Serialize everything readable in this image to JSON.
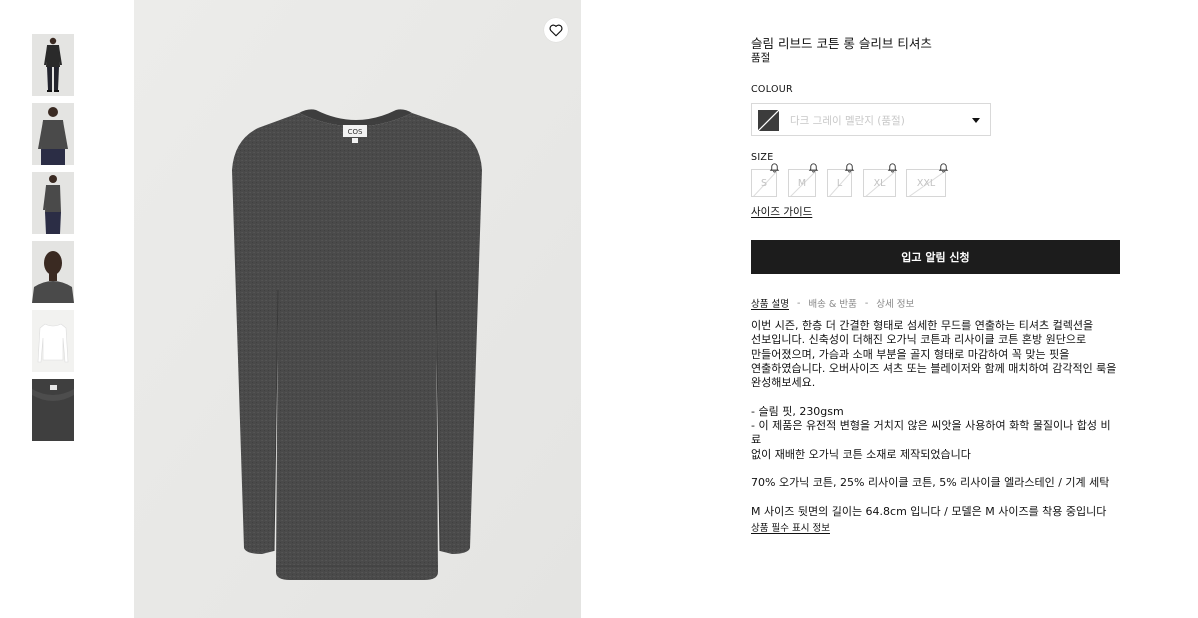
{
  "gallery": {
    "thumbnails": [
      {
        "alt": "model-full-front"
      },
      {
        "alt": "model-half-front"
      },
      {
        "alt": "model-side"
      },
      {
        "alt": "model-face-closeup"
      },
      {
        "alt": "product-flat-white"
      },
      {
        "alt": "fabric-closeup"
      }
    ],
    "main_label": "COS"
  },
  "product": {
    "title": "슬림 리브드 코튼 롱 슬리브 티셔츠",
    "stock_status": "품절",
    "colour_label": "COLOUR",
    "colour_value": "다크 그레이 멜란지 (품절)",
    "size_label": "SIZE",
    "sizes": [
      "S",
      "M",
      "L",
      "XL",
      "XXL"
    ],
    "size_guide": "사이즈 가이드",
    "notify_button": "입고 알림 신청"
  },
  "tabs": {
    "items": [
      "상품 설명",
      "배송 & 반품",
      "상세 정보"
    ],
    "separator": "-"
  },
  "description": {
    "lines_intro": [
      "이번 시즌, 한층 더 간결한 형태로 섬세한 무드를 연출하는 티셔츠 컬렉션을",
      "선보입니다. 신축성이 더해진 오가닉 코튼과 리사이클 코튼 혼방 원단으로",
      "만들어졌으며, 가슴과 소매 부분을 골지 형태로 마감하여 꼭 맞는 핏을",
      "연출하였습니다. 오버사이즈 셔츠 또는 블레이저와 함께 매치하여 감각적인 룩을",
      "완성해보세요."
    ],
    "lines_spec": [
      "- 슬림 핏, 230gsm",
      "- 이 제품은 유전적 변형을 거치지 않은 씨앗을 사용하여 화학 물질이나 합성 비료",
      "없이 재배한 오가닉 코튼 소재로 제작되었습니다"
    ],
    "composition": "70% 오가닉 코튼, 25% 리사이클 코튼, 5% 리사이클 엘라스테인 / 기계 세탁",
    "fit_note": "M 사이즈 뒷면의 길이는 64.8cm 입니다 / 모델은 M 사이즈를 착용 중입니다",
    "legal_link": "상품 필수 표시 정보"
  },
  "colors": {
    "button_bg": "#1c1c1c",
    "garment": "#4a4a4a",
    "image_bg": "#ececea",
    "disabled_text": "#c2c2c2"
  }
}
